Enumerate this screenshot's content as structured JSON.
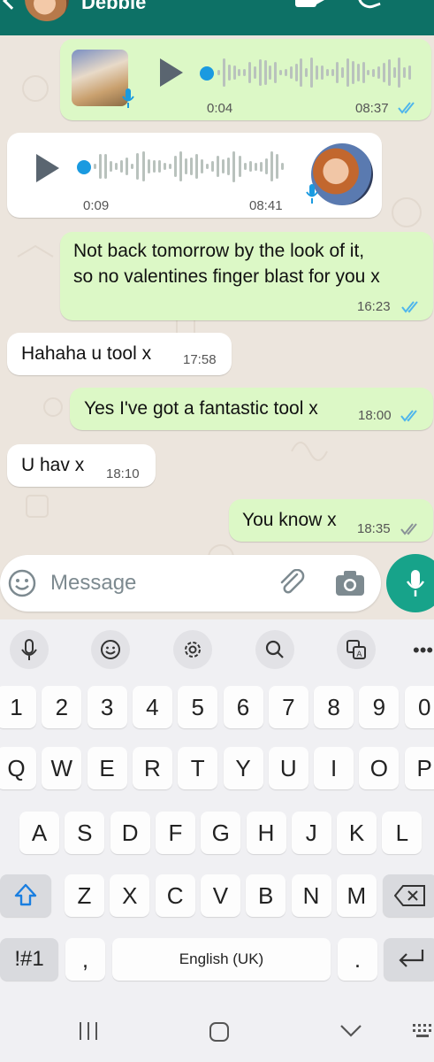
{
  "header": {
    "contact_name": "Debbie"
  },
  "messages": [
    {
      "type": "voice",
      "direction": "out",
      "duration": "0:04",
      "time": "08:37",
      "status": "read"
    },
    {
      "type": "voice",
      "direction": "in",
      "duration": "0:09",
      "time": "08:41"
    },
    {
      "type": "text",
      "direction": "out",
      "line1": "Not back tomorrow by the look of it,",
      "line2": "so no valentines finger blast for you x",
      "time": "16:23",
      "status": "read"
    },
    {
      "type": "text",
      "direction": "in",
      "text": "Hahaha u tool x",
      "time": "17:58"
    },
    {
      "type": "text",
      "direction": "out",
      "text": "Yes I've got a fantastic tool x",
      "time": "18:00",
      "status": "read"
    },
    {
      "type": "text",
      "direction": "in",
      "text": "U hav x",
      "time": "18:10"
    },
    {
      "type": "text",
      "direction": "out",
      "text": "You know x",
      "time": "18:35",
      "status": "delivered"
    }
  ],
  "input": {
    "placeholder": "Message"
  },
  "colors": {
    "header": "#0d7166",
    "outgoing": "#dcf8c6",
    "incoming": "#ffffff",
    "read_tick": "#4fb6ec",
    "mic_button": "#17a38a"
  },
  "keyboard": {
    "toolbar": [
      "mic-icon",
      "emoji-icon",
      "settings-icon",
      "search-icon",
      "translate-icon",
      "more-icon"
    ],
    "row_numbers": [
      "1",
      "2",
      "3",
      "4",
      "5",
      "6",
      "7",
      "8",
      "9",
      "0"
    ],
    "row1": [
      "Q",
      "W",
      "E",
      "R",
      "T",
      "Y",
      "U",
      "I",
      "O",
      "P"
    ],
    "row2": [
      "A",
      "S",
      "D",
      "F",
      "G",
      "H",
      "J",
      "K",
      "L"
    ],
    "row3": [
      "Z",
      "X",
      "C",
      "V",
      "B",
      "N",
      "M"
    ],
    "symbols": "!#1",
    "comma": ",",
    "space": "English (UK)",
    "period": "."
  },
  "nav": [
    "recents-icon",
    "home-icon",
    "back-icon",
    "keyboard-icon"
  ]
}
